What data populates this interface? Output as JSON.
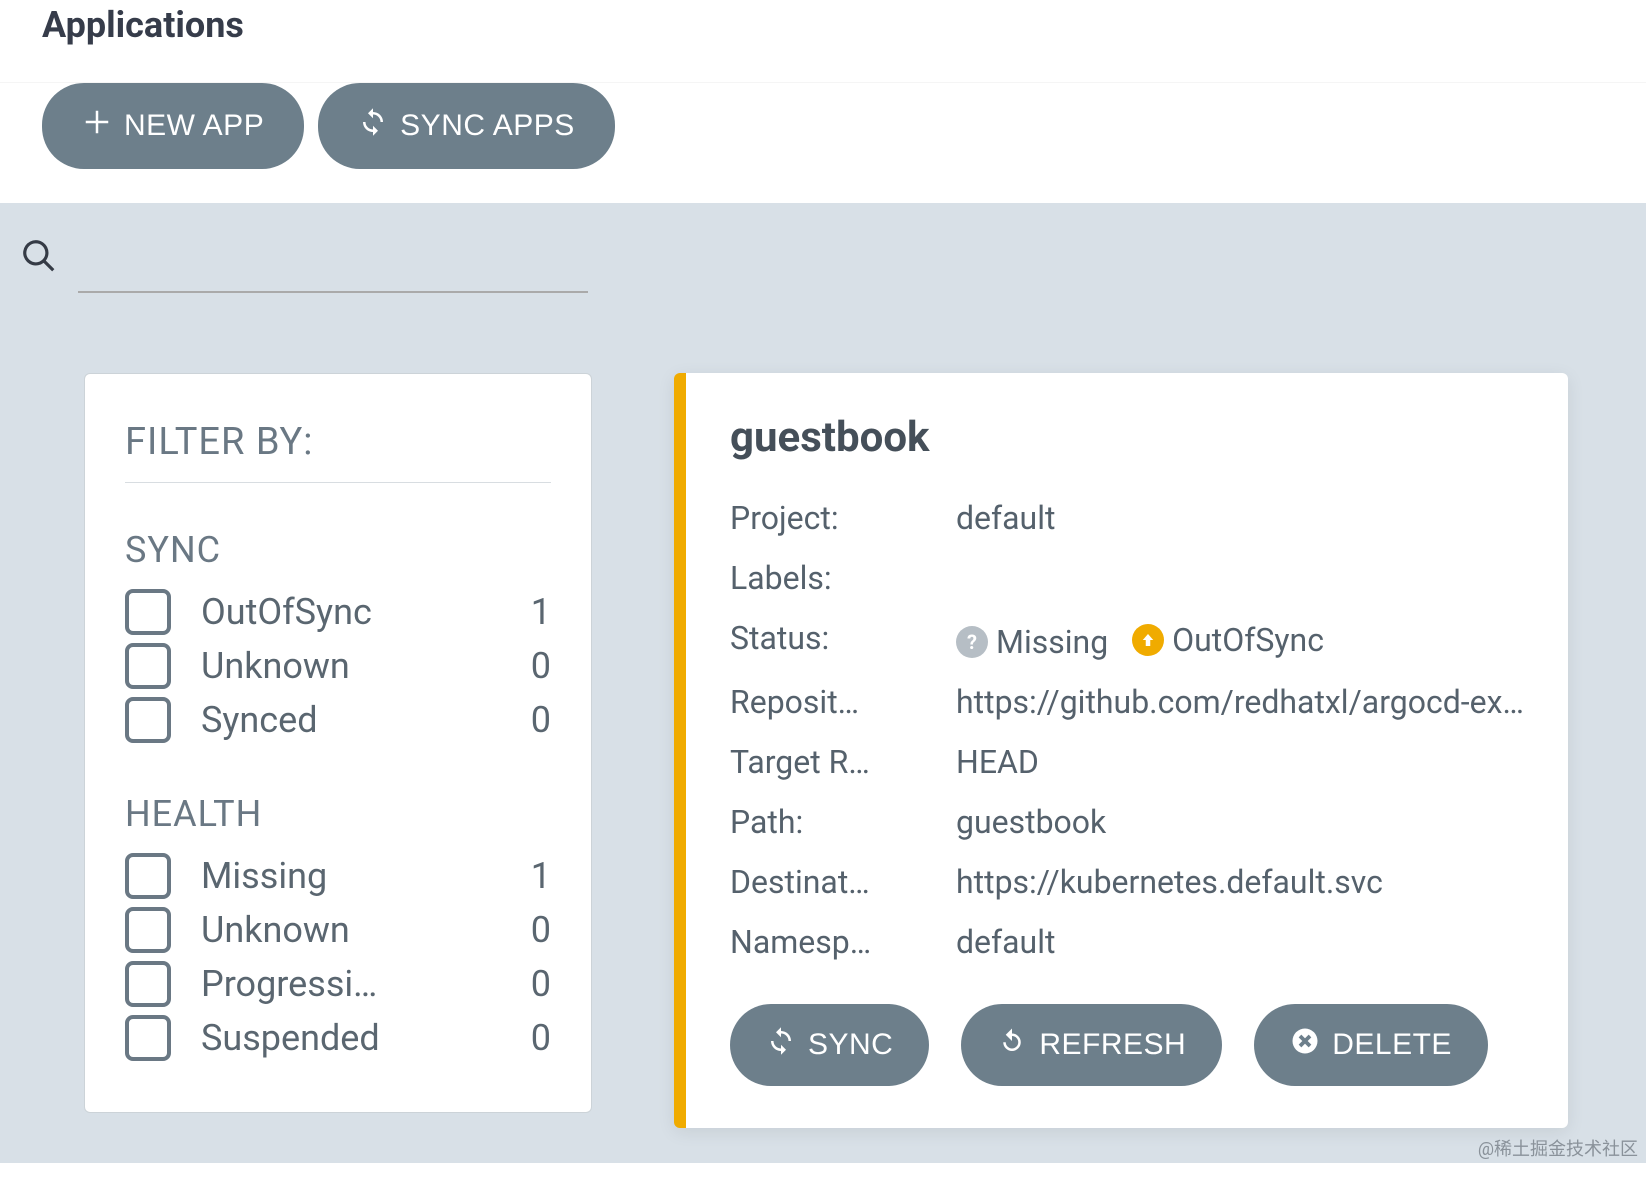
{
  "page": {
    "title": "Applications"
  },
  "toolbar": {
    "new_app_label": "NEW APP",
    "sync_apps_label": "SYNC APPS"
  },
  "filter": {
    "title": "FILTER BY:",
    "sections": [
      {
        "title": "SYNC",
        "items": [
          {
            "label": "OutOfSync",
            "count": 1
          },
          {
            "label": "Unknown",
            "count": 0
          },
          {
            "label": "Synced",
            "count": 0
          }
        ]
      },
      {
        "title": "HEALTH",
        "items": [
          {
            "label": "Missing",
            "count": 1
          },
          {
            "label": "Unknown",
            "count": 0
          },
          {
            "label": "Progressi…",
            "count": 0
          },
          {
            "label": "Suspended",
            "count": 0
          }
        ]
      }
    ]
  },
  "app": {
    "name": "guestbook",
    "fields": {
      "project_label": "Project:",
      "project_value": "default",
      "labels_label": "Labels:",
      "labels_value": "",
      "status_label": "Status:",
      "status_missing_text": "Missing",
      "status_outofsync_text": "OutOfSync",
      "repo_label": "Reposit…",
      "repo_value": "https://github.com/redhatxl/argocd-ex…",
      "target_label": "Target R…",
      "target_value": "HEAD",
      "path_label": "Path:",
      "path_value": "guestbook",
      "dest_label": "Destinat…",
      "dest_value": "https://kubernetes.default.svc",
      "ns_label": "Namesp…",
      "ns_value": "default"
    },
    "actions": {
      "sync_label": "SYNC",
      "refresh_label": "REFRESH",
      "delete_label": "DELETE"
    }
  },
  "watermark": "@稀土掘金技术社区"
}
